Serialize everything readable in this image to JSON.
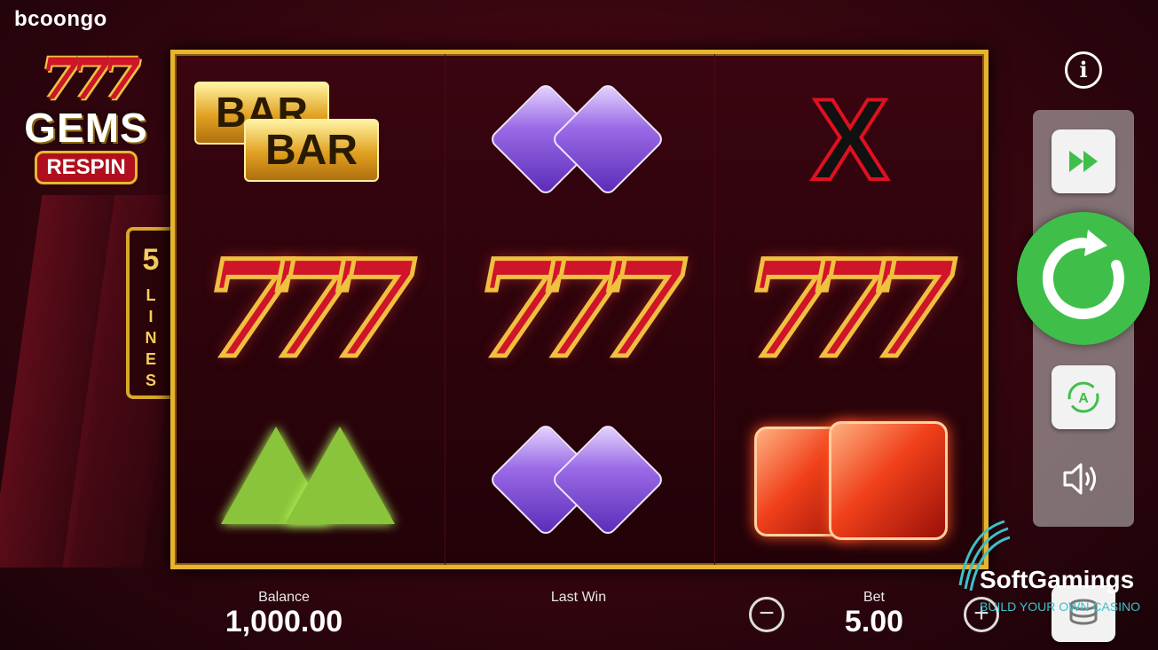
{
  "brand": "bcoongo",
  "game_logo": {
    "sevens": "777",
    "gems": "GEMS",
    "respin": "RESPIN"
  },
  "lines": {
    "count": "5",
    "word": "LINES"
  },
  "reels": [
    [
      "bar-bar",
      "seven-triple",
      "green-gems"
    ],
    [
      "purple-gems",
      "seven-triple",
      "purple-gems"
    ],
    [
      "x-symbol",
      "seven-triple",
      "red-gems"
    ]
  ],
  "symbols": {
    "bar_top": "BAR",
    "bar_bottom": "BAR",
    "seven": "777",
    "x": "X"
  },
  "footer": {
    "balance_label": "Balance",
    "balance_value": "1,000.00",
    "last_win_label": "Last Win",
    "bet_label": "Bet",
    "bet_value": "5.00",
    "minus": "−",
    "plus": "+"
  },
  "controls": {
    "info": "i"
  },
  "watermark": {
    "name": "SoftGamings",
    "tagline": "BUILD YOUR OWN CASINO"
  },
  "colors": {
    "frame_gold": "#e6b42e",
    "spin_green": "#3fbf4a",
    "seven_red": "#d0142a",
    "background": "#3a0610"
  }
}
